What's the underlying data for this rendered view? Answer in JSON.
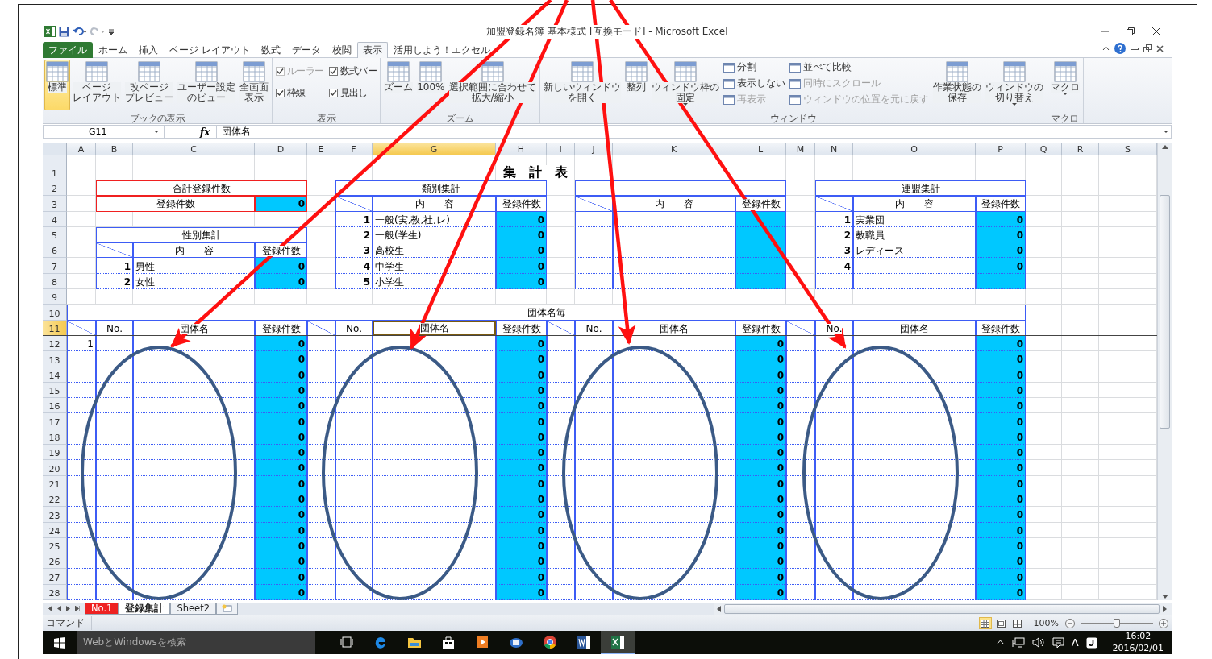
{
  "window": {
    "title": "加盟登録名簿 基本様式 [互換モード] - Microsoft Excel"
  },
  "ribbon_tabs": [
    {
      "label": "ファイル",
      "kind": "file",
      "selected": false
    },
    {
      "label": "ホーム",
      "kind": "tab",
      "selected": false
    },
    {
      "label": "挿入",
      "kind": "tab",
      "selected": false
    },
    {
      "label": "ページ レイアウト",
      "kind": "tab",
      "selected": false
    },
    {
      "label": "数式",
      "kind": "tab",
      "selected": false
    },
    {
      "label": "データ",
      "kind": "tab",
      "selected": false
    },
    {
      "label": "校閲",
      "kind": "tab",
      "selected": false
    },
    {
      "label": "表示",
      "kind": "tab",
      "selected": true
    },
    {
      "label": "活用しよう！エクセル",
      "kind": "tab",
      "selected": false
    }
  ],
  "ribbon_groups": [
    {
      "label": "ブックの表示",
      "items": [
        {
          "kind": "large",
          "lines": [
            "標準"
          ],
          "selected": true
        },
        {
          "kind": "large",
          "lines": [
            "ページ",
            "レイアウト"
          ],
          "selected": false
        },
        {
          "kind": "large",
          "lines": [
            "改ページ",
            "プレビュー"
          ],
          "selected": false
        },
        {
          "kind": "large",
          "lines": [
            "ユーザー設定",
            "のビュー"
          ],
          "selected": false
        },
        {
          "kind": "large",
          "lines": [
            "全画面",
            "表示"
          ],
          "selected": false
        }
      ]
    },
    {
      "label": "表示",
      "items": [
        {
          "kind": "check",
          "label": "ルーラー",
          "checked": true,
          "disabled": true
        },
        {
          "kind": "check",
          "label": "数式バー",
          "checked": true,
          "disabled": false
        },
        {
          "kind": "check",
          "label": "枠線",
          "checked": true,
          "disabled": false
        },
        {
          "kind": "check",
          "label": "見出し",
          "checked": true,
          "disabled": false
        }
      ]
    },
    {
      "label": "ズーム",
      "items": [
        {
          "kind": "large",
          "lines": [
            "ズーム"
          ],
          "selected": false
        },
        {
          "kind": "large",
          "lines": [
            "100%"
          ],
          "selected": false
        },
        {
          "kind": "large",
          "lines": [
            "選択範囲に合わせて",
            "拡大/縮小"
          ],
          "selected": false
        }
      ]
    },
    {
      "label": "ウィンドウ",
      "items": [
        {
          "kind": "large",
          "lines": [
            "新しいウィンドウ",
            "を開く"
          ],
          "selected": false
        },
        {
          "kind": "large",
          "lines": [
            "整列"
          ],
          "selected": false
        },
        {
          "kind": "large",
          "lines": [
            "ウィンドウ枠の",
            "固定"
          ],
          "selected": false,
          "dropdown": true
        },
        {
          "kind": "small",
          "label": "分割",
          "disabled": false
        },
        {
          "kind": "small",
          "label": "表示しない",
          "disabled": false
        },
        {
          "kind": "small",
          "label": "再表示",
          "disabled": true
        },
        {
          "kind": "small",
          "label": "並べて比較",
          "disabled": false
        },
        {
          "kind": "small",
          "label": "同時にスクロール",
          "disabled": true
        },
        {
          "kind": "small",
          "label": "ウィンドウの位置を元に戻す",
          "disabled": true
        },
        {
          "kind": "large",
          "lines": [
            "作業状態の",
            "保存"
          ],
          "selected": false
        },
        {
          "kind": "large",
          "lines": [
            "ウィンドウの",
            "切り替え"
          ],
          "selected": false,
          "dropdown": true
        }
      ]
    },
    {
      "label": "マクロ",
      "items": [
        {
          "kind": "large",
          "lines": [
            "マクロ"
          ],
          "selected": false,
          "dropdown": true
        }
      ]
    }
  ],
  "formula_bar": {
    "name_box": "G11",
    "fx_label": "fx",
    "value": "団体名"
  },
  "sheet": {
    "column_headers": [
      {
        "label": "A",
        "selected": false
      },
      {
        "label": "B",
        "selected": false
      },
      {
        "label": "C",
        "selected": false
      },
      {
        "label": "D",
        "selected": false
      },
      {
        "label": "E",
        "selected": false
      },
      {
        "label": "F",
        "selected": false
      },
      {
        "label": "G",
        "selected": true
      },
      {
        "label": "H",
        "selected": false
      },
      {
        "label": "I",
        "selected": false
      },
      {
        "label": "J",
        "selected": false
      },
      {
        "label": "K",
        "selected": false
      },
      {
        "label": "L",
        "selected": false
      },
      {
        "label": "M",
        "selected": false
      },
      {
        "label": "N",
        "selected": false
      },
      {
        "label": "O",
        "selected": false
      },
      {
        "label": "P",
        "selected": false
      },
      {
        "label": "Q",
        "selected": false
      },
      {
        "label": "R",
        "selected": false
      },
      {
        "label": "S",
        "selected": false
      }
    ],
    "row_headers": [
      {
        "label": "1",
        "selected": false
      },
      {
        "label": "2",
        "selected": false
      },
      {
        "label": "3",
        "selected": false
      },
      {
        "label": "4",
        "selected": false
      },
      {
        "label": "5",
        "selected": false
      },
      {
        "label": "6",
        "selected": false
      },
      {
        "label": "7",
        "selected": false
      },
      {
        "label": "8",
        "selected": false
      },
      {
        "label": "9",
        "selected": false
      },
      {
        "label": "10",
        "selected": false
      },
      {
        "label": "11",
        "selected": true
      },
      {
        "label": "12",
        "selected": false
      },
      {
        "label": "13",
        "selected": false
      },
      {
        "label": "14",
        "selected": false
      },
      {
        "label": "15",
        "selected": false
      },
      {
        "label": "16",
        "selected": false
      },
      {
        "label": "17",
        "selected": false
      },
      {
        "label": "18",
        "selected": false
      },
      {
        "label": "19",
        "selected": false
      },
      {
        "label": "20",
        "selected": false
      },
      {
        "label": "21",
        "selected": false
      },
      {
        "label": "22",
        "selected": false
      },
      {
        "label": "23",
        "selected": false
      },
      {
        "label": "24",
        "selected": false
      },
      {
        "label": "25",
        "selected": false
      },
      {
        "label": "26",
        "selected": false
      },
      {
        "label": "27",
        "selected": false
      },
      {
        "label": "28",
        "selected": false
      }
    ],
    "title": "集　計　表",
    "total_summary": {
      "title": "合計登録件数",
      "label": "登録件数",
      "count": "0"
    },
    "gender_summary": {
      "title": "性別集計",
      "header": {
        "content": "内　　容",
        "count": "登録件数"
      },
      "rows": [
        {
          "no": "1",
          "content": "男性",
          "count": "0"
        },
        {
          "no": "2",
          "content": "女性",
          "count": "0"
        }
      ]
    },
    "category_summary": {
      "title": "類別集計",
      "header": {
        "content": "内　　容",
        "count": "登録件数"
      },
      "rows": [
        {
          "no": "1",
          "content": "一般(実,教,社,レ)",
          "count": "0"
        },
        {
          "no": "2",
          "content": "一般(学生)",
          "count": "0"
        },
        {
          "no": "3",
          "content": "高校生",
          "count": "0"
        },
        {
          "no": "4",
          "content": "中学生",
          "count": "0"
        },
        {
          "no": "5",
          "content": "小学生",
          "count": "0"
        }
      ]
    },
    "untitled_summary": {
      "header": {
        "content": "内　　容",
        "count": "登録件数"
      }
    },
    "league_summary": {
      "title": "連盟集計",
      "header": {
        "content": "内　　容",
        "count": "登録件数"
      },
      "rows": [
        {
          "no": "1",
          "content": "実業団",
          "count": "0"
        },
        {
          "no": "2",
          "content": "教職員",
          "count": "0"
        },
        {
          "no": "3",
          "content": "レディース",
          "count": "0"
        },
        {
          "no": "4",
          "count": "0"
        }
      ]
    },
    "group_section": {
      "title": "団体名毎",
      "blocks": [
        {
          "header": {
            "no": "No.",
            "name": "団体名",
            "count": "登録件数",
            "name_selected": false
          },
          "rows": [
            {
              "index": "1",
              "count": "0"
            },
            {
              "count": "0"
            },
            {
              "count": "0"
            },
            {
              "count": "0"
            },
            {
              "count": "0"
            },
            {
              "count": "0"
            },
            {
              "count": "0"
            },
            {
              "count": "0"
            },
            {
              "count": "0"
            },
            {
              "count": "0"
            },
            {
              "count": "0"
            },
            {
              "count": "0"
            },
            {
              "count": "0"
            },
            {
              "count": "0"
            },
            {
              "count": "0"
            },
            {
              "count": "0"
            },
            {
              "count": "0"
            }
          ]
        },
        {
          "header": {
            "no": "No.",
            "name": "団体名",
            "count": "登録件数",
            "name_selected": true
          },
          "rows": [
            {
              "count": "0"
            },
            {
              "count": "0"
            },
            {
              "count": "0"
            },
            {
              "count": "0"
            },
            {
              "count": "0"
            },
            {
              "count": "0"
            },
            {
              "count": "0"
            },
            {
              "count": "0"
            },
            {
              "count": "0"
            },
            {
              "count": "0"
            },
            {
              "count": "0"
            },
            {
              "count": "0"
            },
            {
              "count": "0"
            },
            {
              "count": "0"
            },
            {
              "count": "0"
            },
            {
              "count": "0"
            },
            {
              "count": "0"
            }
          ]
        },
        {
          "header": {
            "no": "No.",
            "name": "団体名",
            "count": "登録件数",
            "name_selected": false
          },
          "rows": [
            {
              "count": "0"
            },
            {
              "count": "0"
            },
            {
              "count": "0"
            },
            {
              "count": "0"
            },
            {
              "count": "0"
            },
            {
              "count": "0"
            },
            {
              "count": "0"
            },
            {
              "count": "0"
            },
            {
              "count": "0"
            },
            {
              "count": "0"
            },
            {
              "count": "0"
            },
            {
              "count": "0"
            },
            {
              "count": "0"
            },
            {
              "count": "0"
            },
            {
              "count": "0"
            },
            {
              "count": "0"
            },
            {
              "count": "0"
            }
          ]
        },
        {
          "header": {
            "no": "No.",
            "name": "団体名",
            "count": "登録件数",
            "name_selected": false
          },
          "rows": [
            {
              "count": "0"
            },
            {
              "count": "0"
            },
            {
              "count": "0"
            },
            {
              "count": "0"
            },
            {
              "count": "0"
            },
            {
              "count": "0"
            },
            {
              "count": "0"
            },
            {
              "count": "0"
            },
            {
              "count": "0"
            },
            {
              "count": "0"
            },
            {
              "count": "0"
            },
            {
              "count": "0"
            },
            {
              "count": "0"
            },
            {
              "count": "0"
            },
            {
              "count": "0"
            },
            {
              "count": "0"
            },
            {
              "count": "0"
            }
          ]
        }
      ]
    }
  },
  "sheet_tabs": [
    {
      "label": "No.1",
      "selected": false,
      "color": "#ee2222"
    },
    {
      "label": "登録集計",
      "selected": true
    },
    {
      "label": "Sheet2",
      "selected": false
    }
  ],
  "status_bar": {
    "mode": "コマンド",
    "view_buttons": [
      {
        "kind": "normal",
        "selected": true
      },
      {
        "kind": "page_layout",
        "selected": false
      },
      {
        "kind": "page_break",
        "selected": false
      }
    ],
    "zoom": "100%",
    "zoom_slider": {
      "level": 0.5
    }
  },
  "taskbar": {
    "search_placeholder": "WebとWindowsを検索",
    "apps": [
      {
        "kind": "task_view",
        "selected": false
      },
      {
        "kind": "edge",
        "selected": false
      },
      {
        "kind": "explorer",
        "selected": false
      },
      {
        "kind": "store",
        "selected": false
      },
      {
        "kind": "media",
        "selected": false
      },
      {
        "kind": "mail",
        "selected": false
      },
      {
        "kind": "chrome",
        "selected": false
      },
      {
        "kind": "word",
        "selected": false
      },
      {
        "kind": "excel",
        "selected": true
      }
    ],
    "ime": "A",
    "time": "16:02",
    "date": "2016/02/01"
  }
}
